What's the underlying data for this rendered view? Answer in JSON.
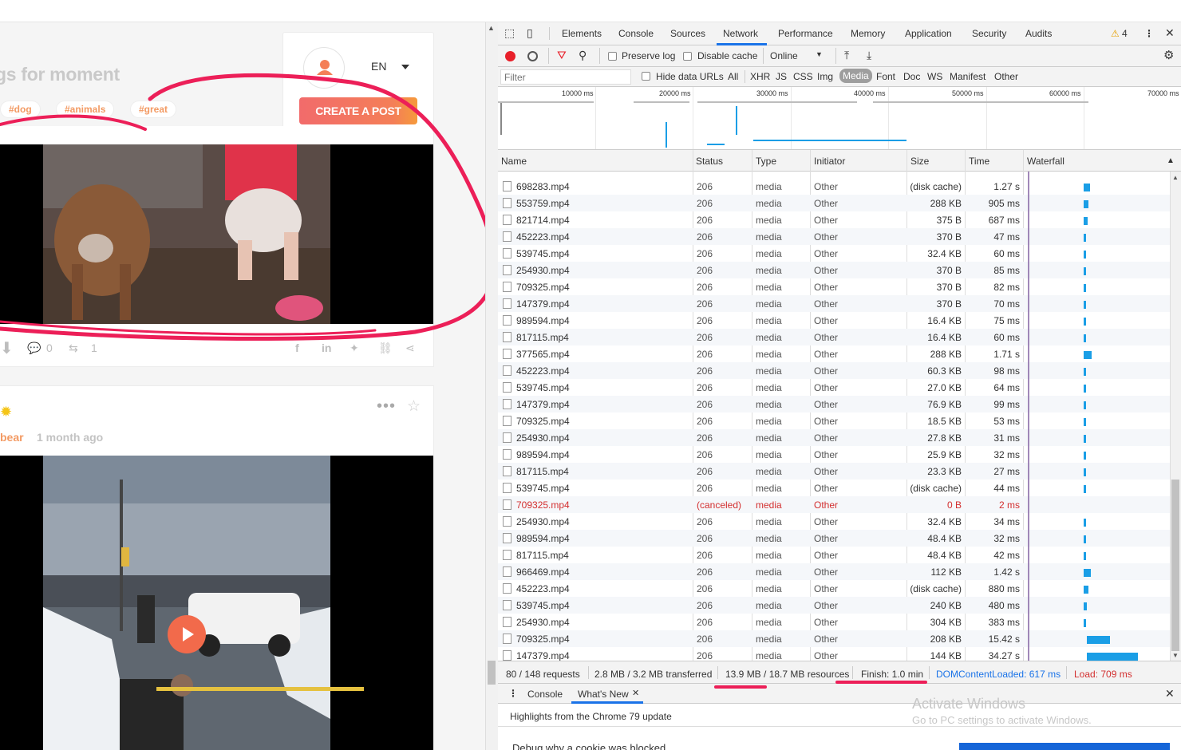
{
  "left": {
    "title": "gs for moment",
    "tags": [
      "#dog",
      "#animals",
      "#great"
    ],
    "language": "EN",
    "create_button": "CREATE A POST",
    "post1": {
      "comments": "0",
      "reposts": "1"
    },
    "post2": {
      "author": "bear",
      "time": "1 month ago"
    }
  },
  "devtools": {
    "tabs": [
      "Elements",
      "Console",
      "Sources",
      "Network",
      "Performance",
      "Memory",
      "Application",
      "Security",
      "Audits"
    ],
    "active_tab": "Network",
    "warnings_count": "4",
    "preserve_log": "Preserve log",
    "disable_cache": "Disable cache",
    "throttle": "Online",
    "filter_placeholder": "Filter",
    "hide_data_urls": "Hide data URLs",
    "type_filters": [
      "All",
      "XHR",
      "JS",
      "CSS",
      "Img",
      "Media",
      "Font",
      "Doc",
      "WS",
      "Manifest",
      "Other"
    ],
    "active_type_filter": "Media",
    "timeline_ticks": [
      "10000 ms",
      "20000 ms",
      "30000 ms",
      "40000 ms",
      "50000 ms",
      "60000 ms",
      "70000 ms"
    ],
    "columns": [
      "Name",
      "Status",
      "Type",
      "Initiator",
      "Size",
      "Time",
      "Waterfall"
    ],
    "rows": [
      {
        "name": "698283.mp4",
        "status": "206",
        "type": "media",
        "initiator": "Other",
        "size": "(disk cache)",
        "time": "1.27 s",
        "w": 0.07
      },
      {
        "name": "553759.mp4",
        "status": "206",
        "type": "media",
        "initiator": "Other",
        "size": "288 KB",
        "time": "905 ms",
        "w": 0.05
      },
      {
        "name": "821714.mp4",
        "status": "206",
        "type": "media",
        "initiator": "Other",
        "size": "375 B",
        "time": "687 ms",
        "w": 0.04
      },
      {
        "name": "452223.mp4",
        "status": "206",
        "type": "media",
        "initiator": "Other",
        "size": "370 B",
        "time": "47 ms",
        "w": 0.01
      },
      {
        "name": "539745.mp4",
        "status": "206",
        "type": "media",
        "initiator": "Other",
        "size": "32.4 KB",
        "time": "60 ms",
        "w": 0.01
      },
      {
        "name": "254930.mp4",
        "status": "206",
        "type": "media",
        "initiator": "Other",
        "size": "370 B",
        "time": "85 ms",
        "w": 0.01
      },
      {
        "name": "709325.mp4",
        "status": "206",
        "type": "media",
        "initiator": "Other",
        "size": "370 B",
        "time": "82 ms",
        "w": 0.01
      },
      {
        "name": "147379.mp4",
        "status": "206",
        "type": "media",
        "initiator": "Other",
        "size": "370 B",
        "time": "70 ms",
        "w": 0.01
      },
      {
        "name": "989594.mp4",
        "status": "206",
        "type": "media",
        "initiator": "Other",
        "size": "16.4 KB",
        "time": "75 ms",
        "w": 0.01
      },
      {
        "name": "817115.mp4",
        "status": "206",
        "type": "media",
        "initiator": "Other",
        "size": "16.4 KB",
        "time": "60 ms",
        "w": 0.01
      },
      {
        "name": "377565.mp4",
        "status": "206",
        "type": "media",
        "initiator": "Other",
        "size": "288 KB",
        "time": "1.71 s",
        "w": 0.09
      },
      {
        "name": "452223.mp4",
        "status": "206",
        "type": "media",
        "initiator": "Other",
        "size": "60.3 KB",
        "time": "98 ms",
        "w": 0.01
      },
      {
        "name": "539745.mp4",
        "status": "206",
        "type": "media",
        "initiator": "Other",
        "size": "27.0 KB",
        "time": "64 ms",
        "w": 0.01
      },
      {
        "name": "147379.mp4",
        "status": "206",
        "type": "media",
        "initiator": "Other",
        "size": "76.9 KB",
        "time": "99 ms",
        "w": 0.01
      },
      {
        "name": "709325.mp4",
        "status": "206",
        "type": "media",
        "initiator": "Other",
        "size": "18.5 KB",
        "time": "53 ms",
        "w": 0.01
      },
      {
        "name": "254930.mp4",
        "status": "206",
        "type": "media",
        "initiator": "Other",
        "size": "27.8 KB",
        "time": "31 ms",
        "w": 0.01
      },
      {
        "name": "989594.mp4",
        "status": "206",
        "type": "media",
        "initiator": "Other",
        "size": "25.9 KB",
        "time": "32 ms",
        "w": 0.01
      },
      {
        "name": "817115.mp4",
        "status": "206",
        "type": "media",
        "initiator": "Other",
        "size": "23.3 KB",
        "time": "27 ms",
        "w": 0.01
      },
      {
        "name": "539745.mp4",
        "status": "206",
        "type": "media",
        "initiator": "Other",
        "size": "(disk cache)",
        "time": "44 ms",
        "w": 0.01
      },
      {
        "name": "709325.mp4",
        "status": "(canceled)",
        "type": "media",
        "initiator": "Other",
        "size": "0 B",
        "time": "2 ms",
        "w": 0,
        "canceled": true
      },
      {
        "name": "254930.mp4",
        "status": "206",
        "type": "media",
        "initiator": "Other",
        "size": "32.4 KB",
        "time": "34 ms",
        "w": 0.01
      },
      {
        "name": "989594.mp4",
        "status": "206",
        "type": "media",
        "initiator": "Other",
        "size": "48.4 KB",
        "time": "32 ms",
        "w": 0.01
      },
      {
        "name": "817115.mp4",
        "status": "206",
        "type": "media",
        "initiator": "Other",
        "size": "48.4 KB",
        "time": "42 ms",
        "w": 0.01
      },
      {
        "name": "966469.mp4",
        "status": "206",
        "type": "media",
        "initiator": "Other",
        "size": "112 KB",
        "time": "1.42 s",
        "w": 0.08
      },
      {
        "name": "452223.mp4",
        "status": "206",
        "type": "media",
        "initiator": "Other",
        "size": "(disk cache)",
        "time": "880 ms",
        "w": 0.05
      },
      {
        "name": "539745.mp4",
        "status": "206",
        "type": "media",
        "initiator": "Other",
        "size": "240 KB",
        "time": "480 ms",
        "w": 0.03
      },
      {
        "name": "254930.mp4",
        "status": "206",
        "type": "media",
        "initiator": "Other",
        "size": "304 KB",
        "time": "383 ms",
        "w": 0.02
      },
      {
        "name": "709325.mp4",
        "status": "206",
        "type": "media",
        "initiator": "Other",
        "size": "208 KB",
        "time": "15.42 s",
        "w": 0.27
      },
      {
        "name": "147379.mp4",
        "status": "206",
        "type": "media",
        "initiator": "Other",
        "size": "144 KB",
        "time": "34.27 s",
        "w": 0.59
      }
    ],
    "status": {
      "requests": "80 / 148 requests",
      "transferred": "2.8 MB / 3.2 MB transferred",
      "resources": "13.9 MB / 18.7 MB resources",
      "finish": "Finish: 1.0 min",
      "dcl": "DOMContentLoaded: 617 ms",
      "load": "Load: 709 ms"
    },
    "drawer_tabs": [
      "Console",
      "What's New"
    ],
    "drawer_highlight": "Highlights from the Chrome 79 update",
    "drawer_item": "Debug why a cookie was blocked",
    "activate_title": "Activate Windows",
    "activate_sub": "Go to PC settings to activate Windows.",
    "colors": {
      "accent": "#1a73e8",
      "bar": "#1a9ee6",
      "record": "#e8202a",
      "error": "#d32f2f",
      "annotation": "#ec1f58",
      "brand": "#f47f57"
    }
  }
}
